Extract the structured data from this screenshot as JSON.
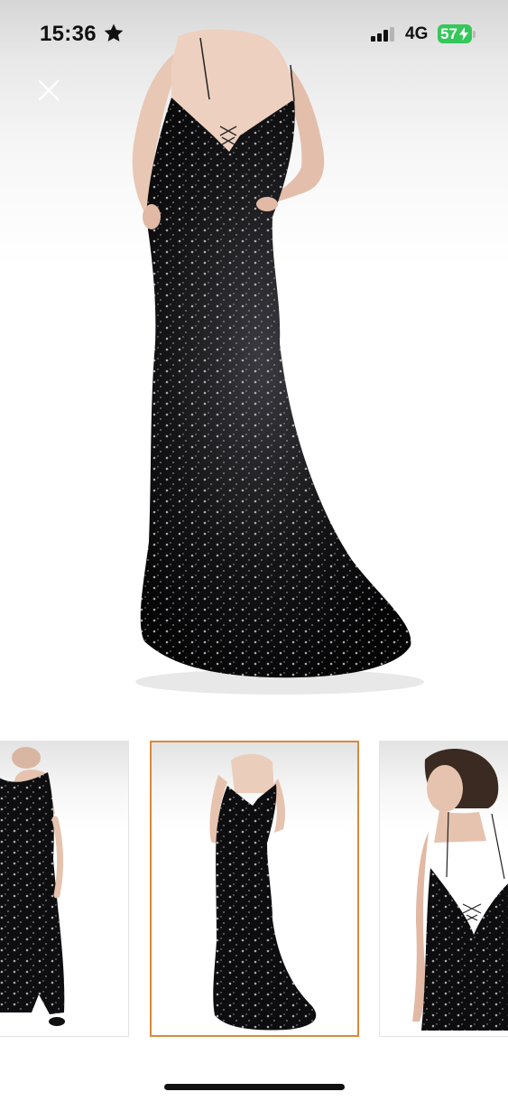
{
  "status_bar": {
    "time": "15:36",
    "star_icon": "star-icon",
    "network": "4G",
    "battery_percent": "57",
    "signal_icon": "cellular-signal-icon",
    "battery_icon": "battery-charging-icon"
  },
  "viewer": {
    "close_icon": "close-icon",
    "main_image_subject": "dress-back-view",
    "thumbnails": [
      {
        "subject": "dress-front-view",
        "selected": false
      },
      {
        "subject": "dress-back-view",
        "selected": true
      },
      {
        "subject": "dress-back-closeup",
        "selected": false
      }
    ],
    "selected_index": 1
  },
  "colors": {
    "selection_border": "#d98a3a",
    "battery_fill": "#34c759",
    "dress": "#0d0d0f"
  }
}
